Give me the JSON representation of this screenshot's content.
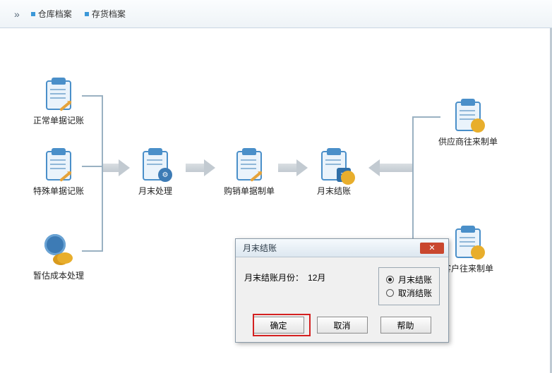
{
  "topbar": {
    "expander": "»",
    "links": [
      "仓库档案",
      "存货档案"
    ]
  },
  "nodes": {
    "normal_posting": "正常单据记账",
    "special_posting": "特殊单据记账",
    "estimate_cost": "暂估成本处理",
    "month_end_process": "月末处理",
    "purchase_sale_voucher": "购销单据制单",
    "month_end_close": "月末结账",
    "supplier_contra": "供应商往来制单",
    "customer_contra": "客户往来制单"
  },
  "dialog": {
    "title": "月末结账",
    "month_label": "月末结账月份：",
    "month_value": "12月",
    "radio_close": "月末结账",
    "radio_cancel": "取消结账",
    "selected_radio": "close",
    "ok": "确定",
    "cancel": "取消",
    "help": "帮助"
  }
}
